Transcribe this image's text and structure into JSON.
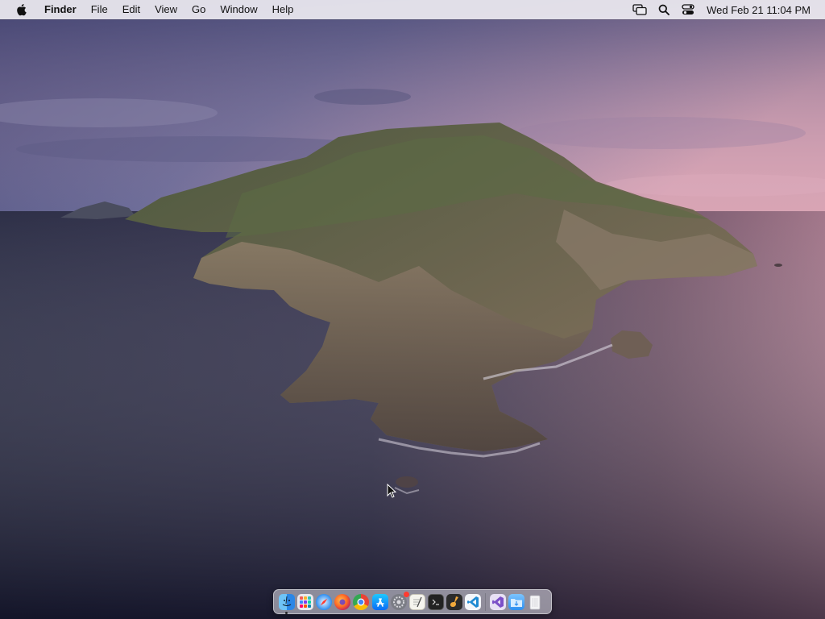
{
  "menubar": {
    "apple_icon": "apple-logo",
    "app_name": "Finder",
    "items": [
      "File",
      "Edit",
      "View",
      "Go",
      "Window",
      "Help"
    ],
    "status_icons": [
      "screen-mirroring-icon",
      "spotlight-search-icon",
      "control-center-icon"
    ],
    "clock": "Wed Feb 21  11:04 PM"
  },
  "dock": {
    "apps": [
      {
        "name": "Finder",
        "icon": "finder-icon",
        "running": true
      },
      {
        "name": "Launchpad",
        "icon": "launchpad-icon",
        "running": false
      },
      {
        "name": "Safari",
        "icon": "safari-icon",
        "running": false
      },
      {
        "name": "Firefox",
        "icon": "firefox-icon",
        "running": false
      },
      {
        "name": "Google Chrome",
        "icon": "chrome-icon",
        "running": false
      },
      {
        "name": "App Store",
        "icon": "app-store-icon",
        "running": false
      },
      {
        "name": "System Preferences",
        "icon": "system-preferences-icon",
        "running": false,
        "badge": true
      },
      {
        "name": "TextEdit",
        "icon": "textedit-icon",
        "running": false
      },
      {
        "name": "Terminal",
        "icon": "terminal-icon",
        "running": false
      },
      {
        "name": "GarageBand",
        "icon": "garageband-icon",
        "running": false
      },
      {
        "name": "Visual Studio Code",
        "icon": "vscode-icon",
        "running": false
      }
    ],
    "others": [
      {
        "name": "Visual Studio",
        "icon": "visual-studio-icon"
      },
      {
        "name": "Downloads",
        "icon": "downloads-folder-icon"
      },
      {
        "name": "Trash",
        "icon": "trash-icon"
      }
    ]
  },
  "colors": {
    "sky_top": "#4e4f7d",
    "sky_pink": "#c79aae",
    "sea_dark": "#1b1d33",
    "sea_pink": "#8a5f74"
  }
}
